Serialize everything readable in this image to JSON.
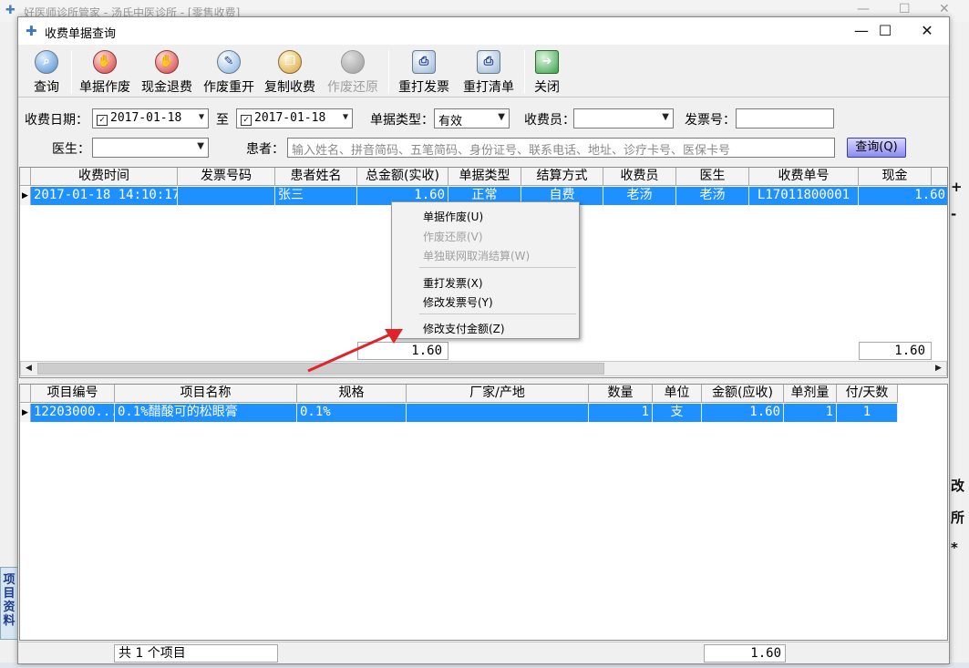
{
  "background_app": {
    "title": "好医师诊所管家 - 汤氏中医诊所 - [零售收费]",
    "left_tab_label": "项目资料",
    "right_chars": [
      "改",
      "所",
      "*"
    ],
    "side_marks": [
      "+",
      "-"
    ]
  },
  "dialog": {
    "title": "收费单据查询",
    "controls": {
      "minimize": "—",
      "maximize": "☐",
      "close": "✕"
    }
  },
  "toolbar": {
    "query": "查询",
    "void_receipt": "单据作废",
    "cash_refund": "现金退费",
    "void_reopen": "作废重开",
    "copy_charge": "复制收费",
    "void_restore": "作废还原",
    "reprint_invoice": "重打发票",
    "reprint_list": "重打清单",
    "close": "关闭"
  },
  "filters": {
    "date_label": "收费日期：",
    "date_from": "2017-01-18",
    "date_from_checked": true,
    "to_label": "至",
    "date_to": "2017-01-18",
    "date_to_checked": true,
    "type_label": "单据类型：",
    "type_value": "有效",
    "cashier_label": "收费员：",
    "cashier_value": "",
    "invoice_label": "发票号：",
    "invoice_value": "",
    "doctor_label": "医生：",
    "doctor_value": "",
    "patient_label": "患者：",
    "patient_placeholder": "输入姓名、拼音简码、五笔简码、身份证号、联系电话、地址、诊疗卡号、医保卡号",
    "query_button": "查询(Q)"
  },
  "receipts_grid": {
    "columns": [
      "收费时间",
      "发票号码",
      "患者姓名",
      "总金额(实收)",
      "单据类型",
      "结算方式",
      "收费员",
      "医生",
      "收费单号",
      "现金"
    ],
    "rows": [
      [
        "2017-01-18 14:10:17",
        "",
        "张三",
        "1.60",
        "正常",
        "自费",
        "老汤",
        "老汤",
        "L17011800001",
        "1.60"
      ]
    ],
    "footer_total": "1.60",
    "footer_cash": "1.60"
  },
  "context_menu": {
    "items": [
      {
        "label": "单据作废(U)",
        "enabled": true
      },
      {
        "label": "作废还原(V)",
        "enabled": false
      },
      {
        "label": "单独联网取消结算(W)",
        "enabled": false
      },
      {
        "label": "重打发票(X)",
        "enabled": true
      },
      {
        "label": "修改发票号(Y)",
        "enabled": true
      },
      {
        "label": "修改支付金额(Z)",
        "enabled": true
      }
    ]
  },
  "items_grid": {
    "columns": [
      "项目编号",
      "项目名称",
      "规格",
      "厂家/产地",
      "数量",
      "单位",
      "金额(应收)",
      "单剂量",
      "付/天数"
    ],
    "rows": [
      [
        "12203000...",
        "0.1%醋酸可的松眼膏",
        "0.1%",
        "",
        "1",
        "支",
        "1.60",
        "1",
        "1"
      ]
    ]
  },
  "status_bar": {
    "item_count": "共 1 个项目",
    "total": "1.60"
  },
  "colors": {
    "selection": "#1e90ff",
    "arrow": "#e0232a"
  }
}
